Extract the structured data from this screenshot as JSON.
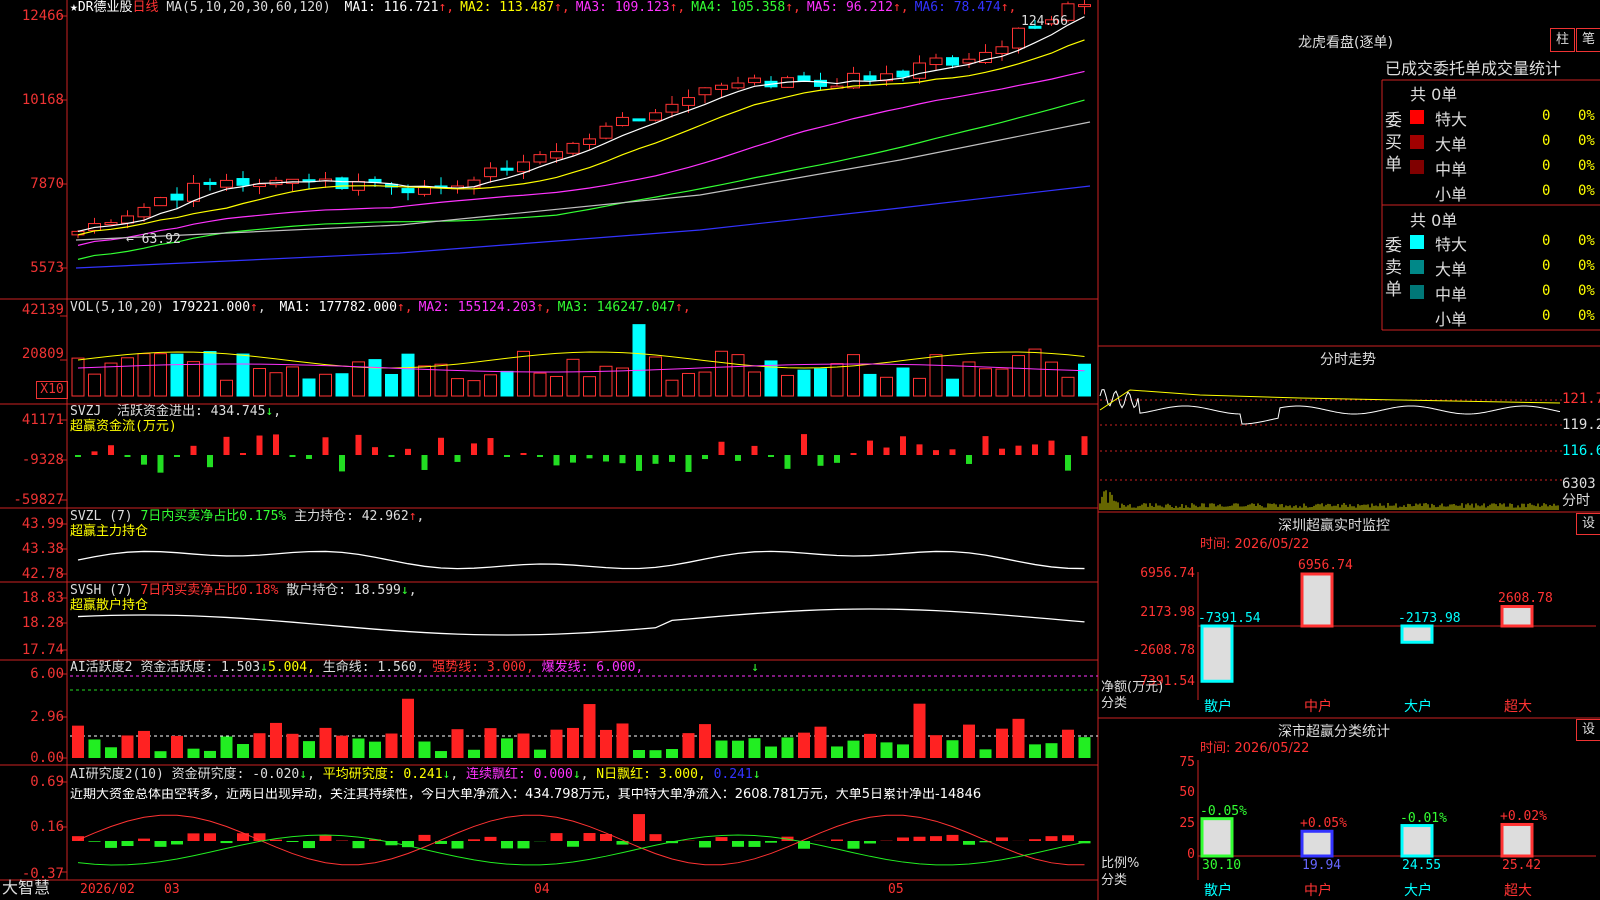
{
  "app": {
    "brand": "大智慧"
  },
  "colors": {
    "up": "#ff3333",
    "down": "#00ffff",
    "ma1": "#ffffff",
    "ma2": "#ffff00",
    "ma3": "#ff33ff",
    "ma4": "#33ff33",
    "ma5": "#c0c0c0",
    "ma6": "#3333ff",
    "grid": "#cc2222"
  },
  "main": {
    "stock_name": "★DR德业股",
    "period": "日线",
    "ma_label": "MA(5,10,20,30,60,120)",
    "ma": [
      {
        "label": "MA1: 116.721",
        "color": "#ffffff"
      },
      {
        "label": "MA2: 113.487",
        "color": "#ffff00"
      },
      {
        "label": "MA3: 109.123",
        "color": "#ff33ff"
      },
      {
        "label": "MA4: 105.358",
        "color": "#33ff33"
      },
      {
        "label": "MA5: 96.212",
        "color": "#ff33ff"
      },
      {
        "label": "MA6: 78.474",
        "color": "#3333ff"
      }
    ],
    "y_labels": [
      "12466",
      "10168",
      "7870",
      "5573"
    ],
    "high_label": "124.66",
    "low_label": "63.92"
  },
  "vol": {
    "title": "VOL(5,10,20)",
    "value": "179221.000",
    "ma": [
      {
        "label": "MA1: 177782.000",
        "color": "#ffffff"
      },
      {
        "label": "MA2: 155124.203",
        "color": "#ff33ff"
      },
      {
        "label": "MA3: 146247.047",
        "color": "#33ff33"
      }
    ],
    "y_labels": [
      "42139",
      "20809"
    ],
    "unit": "X10"
  },
  "svzj": {
    "title": "SVZJ",
    "line1": "活跃资金进出: 434.745",
    "line2": "超赢资金流(万元)",
    "y_labels": [
      "41171",
      "-9328",
      "-59827"
    ]
  },
  "svzl": {
    "title": "SVZL (7)",
    "pct": "7日内买卖净占比0.175%",
    "hold": "主力持仓: 42.962",
    "line2": "超赢主力持仓",
    "y_labels": [
      "43.99",
      "43.38",
      "42.78"
    ]
  },
  "svsh": {
    "title": "SVSH (7)",
    "pct": "7日内买卖净占比0.18%",
    "hold": "散户持仓: 18.599",
    "line2": "超赢散户持仓",
    "y_labels": [
      "18.83",
      "18.28",
      "17.74"
    ]
  },
  "ai1": {
    "title": "AI活跃度2",
    "a": "资金活跃度: 1.503",
    "b": "5.004,",
    "c": "生命线: 1.560,",
    "d": "强势线: 3.000,",
    "e": "爆发线: 6.000,",
    "y_labels": [
      "6.00",
      "2.96",
      "0.00"
    ]
  },
  "ai2": {
    "title": "AI研究度2(10)",
    "a": "资金研究度: -0.020",
    "b": "平均研究度: 0.241",
    "c": "连续飘红: 0.000",
    "d": "N日飘红: 3.000,",
    "e": "0.241",
    "comment": "近期大资金总体由空转多，近两日出现异动，关注其持续性，今日大单净流入：434.798万元，其中特大单净流入：2608.781万元，大单5日累计净出-14846",
    "y_labels": [
      "0.69",
      "0.16",
      "-0.37"
    ]
  },
  "xaxis": {
    "labels": [
      "2026/02",
      "03",
      "04",
      "05"
    ]
  },
  "lhb": {
    "title": "龙虎看盘(逐单)",
    "btn_bar": "柱",
    "btn_pen": "笔",
    "subtitle": "已成交委托单成交量统计",
    "buy_label": "委买单",
    "sell_label": "委卖单",
    "buy_total": "共 0单",
    "sell_total": "共 0单",
    "buy_rows": [
      {
        "name": "特大",
        "count": "0",
        "pct": "0%",
        "color": "#ff0000"
      },
      {
        "name": "大单",
        "count": "0",
        "pct": "0%",
        "color": "#a00000"
      },
      {
        "name": "中单",
        "count": "0",
        "pct": "0%",
        "color": "#800000"
      },
      {
        "name": "小单",
        "count": "0",
        "pct": "0%",
        "color": "#000000"
      }
    ],
    "sell_rows": [
      {
        "name": "特大",
        "count": "0",
        "pct": "0%",
        "color": "#00ffff"
      },
      {
        "name": "大单",
        "count": "0",
        "pct": "0%",
        "color": "#008888"
      },
      {
        "name": "中单",
        "count": "0",
        "pct": "0%",
        "color": "#007777"
      },
      {
        "name": "小单",
        "count": "0",
        "pct": "0%",
        "color": "#000000"
      }
    ]
  },
  "intraday": {
    "title": "分时走势",
    "price_labels": [
      "121.7",
      "119.2",
      "116.6"
    ],
    "vol_label": "6303",
    "unit_label": "分时"
  },
  "szjk": {
    "title": "深圳超赢实时监控",
    "btn": "设",
    "time": "时间: 2026/05/22",
    "y_labels": [
      "6956.74",
      "2173.98",
      "-2608.78",
      "-7391.54"
    ],
    "ylabel1": "净额(万元)",
    "ylabel2": "分类",
    "categories": [
      "散户",
      "中户",
      "大户",
      "超大"
    ],
    "values": [
      "-7391.54",
      "6956.74",
      "-2173.98",
      "2608.78"
    ]
  },
  "fltj": {
    "title": "深市超赢分类统计",
    "btn": "设",
    "time": "时间: 2026/05/22",
    "y_labels": [
      "75",
      "50",
      "25",
      "0"
    ],
    "ylabel1": "比例%",
    "ylabel2": "分类",
    "categories": [
      "散户",
      "中户",
      "大户",
      "超大"
    ],
    "pcts": [
      "-0.05%",
      "+0.05%",
      "-0.01%",
      "+0.02%"
    ],
    "values": [
      "30.10",
      "19.94",
      "24.55",
      "25.42"
    ]
  }
}
